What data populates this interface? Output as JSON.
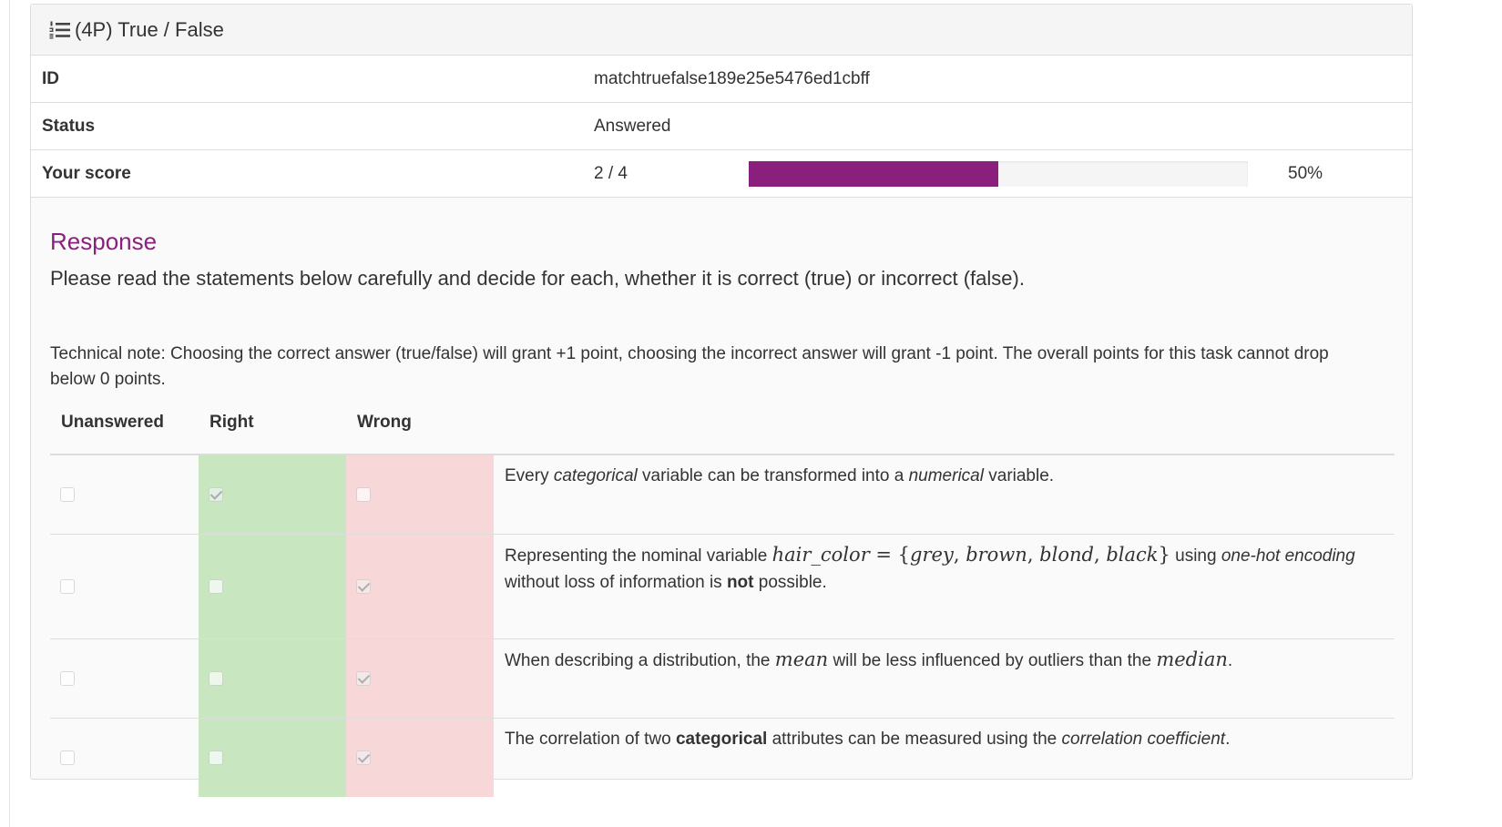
{
  "panel": {
    "title": "(4P) True / False",
    "icon": "list-ol-icon"
  },
  "info": {
    "id_label": "ID",
    "id_value": "matchtruefalse189e25e5476ed1cbff",
    "status_label": "Status",
    "status_value": "Answered",
    "score_label": "Your score",
    "score_value": "2 / 4",
    "score_fraction": 0.5,
    "score_percent": "50%",
    "progress_color": "#8b1f7e"
  },
  "response": {
    "title": "Response",
    "instructions": "Please read the statements below carefully and decide for each, whether it is correct (true) or incorrect (false).",
    "tech_note": "Technical note: Choosing the correct answer (true/false) will grant +1 point, choosing the incorrect answer will grant -1 point. The overall points for this task cannot drop below 0 points."
  },
  "table": {
    "headers": [
      "Unanswered",
      "Right",
      "Wrong"
    ],
    "colors": {
      "right": "#c8e6c0",
      "wrong": "#f8d7d9"
    },
    "rows": [
      {
        "checked": "right",
        "parts": [
          {
            "t": "Every "
          },
          {
            "t": "categorical",
            "s": "em"
          },
          {
            "t": " variable can be transformed into a "
          },
          {
            "t": "numerical",
            "s": "em"
          },
          {
            "t": " variable."
          }
        ]
      },
      {
        "checked": "wrong",
        "parts": [
          {
            "t": "Representing the nominal variable "
          },
          {
            "t": "hair_color",
            "s": "math"
          },
          {
            "t": " = {",
            "s": "mathup"
          },
          {
            "t": "grey",
            "s": "math"
          },
          {
            "t": ", ",
            "s": "mathup"
          },
          {
            "t": "brown",
            "s": "math"
          },
          {
            "t": ", ",
            "s": "mathup"
          },
          {
            "t": "blond",
            "s": "math"
          },
          {
            "t": ", ",
            "s": "mathup"
          },
          {
            "t": "black",
            "s": "math"
          },
          {
            "t": "}",
            "s": "mathup"
          },
          {
            "t": " using "
          },
          {
            "t": "one-hot encoding",
            "s": "em"
          },
          {
            "t": " without loss of information is "
          },
          {
            "t": "not",
            "s": "strong"
          },
          {
            "t": " possible."
          }
        ]
      },
      {
        "checked": "wrong",
        "parts": [
          {
            "t": "When describing a distribution, the "
          },
          {
            "t": "mean",
            "s": "math"
          },
          {
            "t": " will be less influenced by outliers than the "
          },
          {
            "t": "median",
            "s": "math"
          },
          {
            "t": "."
          }
        ]
      },
      {
        "checked": "wrong",
        "parts": [
          {
            "t": "The correlation of two "
          },
          {
            "t": "categorical",
            "s": "strong"
          },
          {
            "t": " attributes can be measured using the "
          },
          {
            "t": "correlation coefficient",
            "s": "em"
          },
          {
            "t": "."
          }
        ]
      }
    ]
  }
}
